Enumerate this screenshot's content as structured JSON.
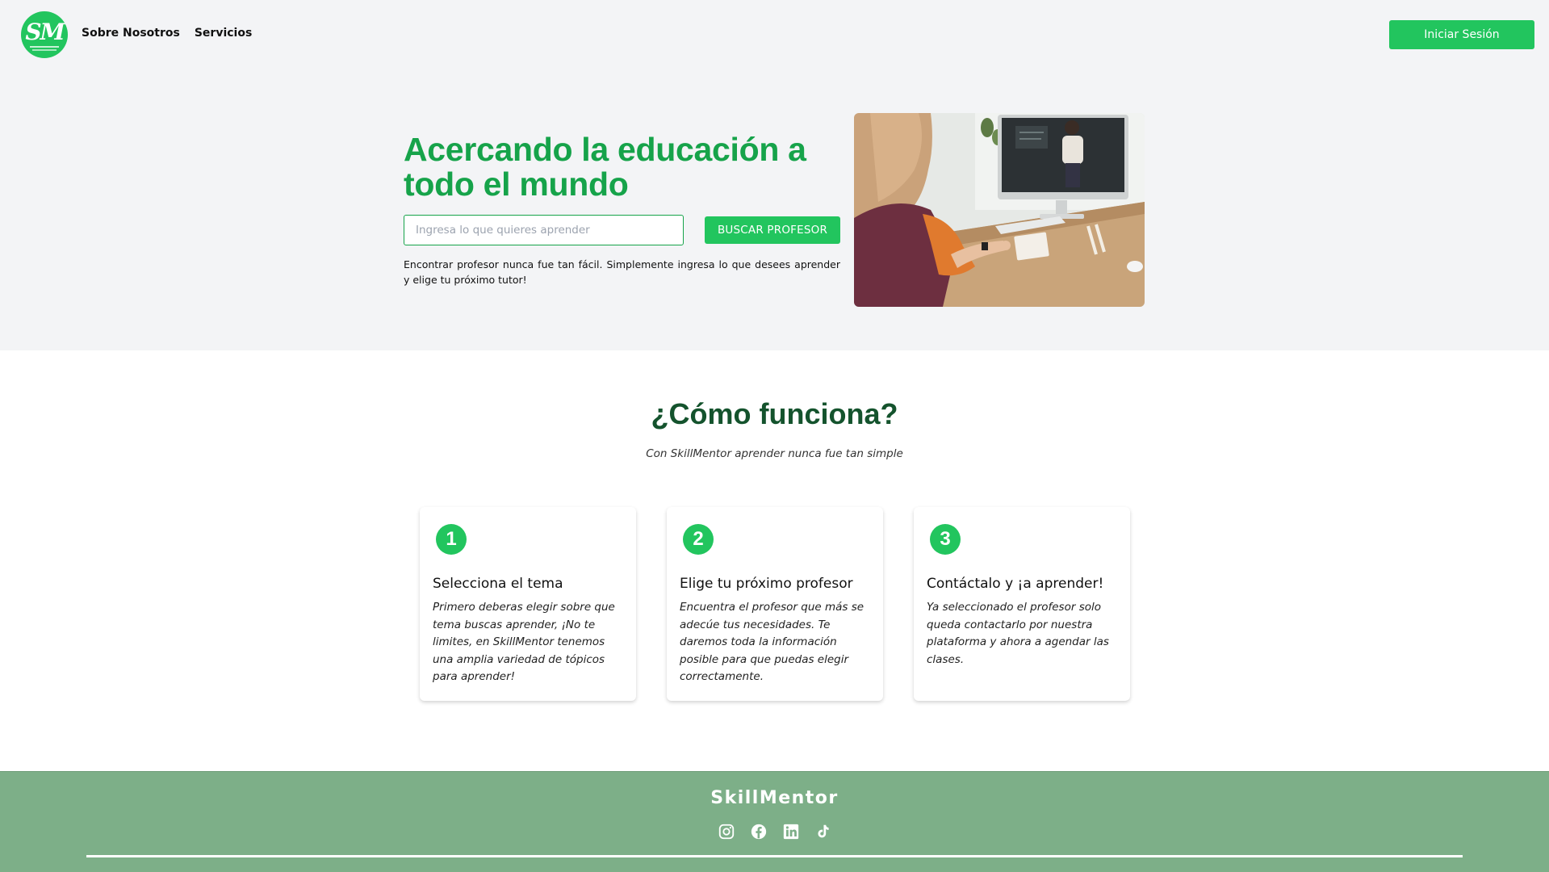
{
  "nav": {
    "logo_text": "SM",
    "links": [
      {
        "label": "Sobre Nosotros"
      },
      {
        "label": "Servicios"
      }
    ],
    "login_label": "Iniciar Sesión"
  },
  "hero": {
    "title": "Acercando la educación a todo el mundo",
    "search_placeholder": "Ingresa lo que quieres aprender",
    "search_button": "BUSCAR PROFESOR",
    "description": "Encontrar profesor nunca fue tan fácil. Simplemente ingresa lo que desees aprender y elige tu próximo tutor!"
  },
  "how": {
    "title": "¿Cómo funciona?",
    "subtitle": "Con SkillMentor aprender nunca fue tan simple",
    "steps": [
      {
        "number": "1",
        "title": "Selecciona el tema",
        "text": "Primero deberas elegir sobre que tema buscas aprender, ¡No te limites, en SkillMentor tenemos una amplia variedad de tópicos para aprender!"
      },
      {
        "number": "2",
        "title": "Elige tu próximo profesor",
        "text": "Encuentra el profesor que más se adecúe tus necesidades. Te daremos toda la información posible para que puedas elegir correctamente."
      },
      {
        "number": "3",
        "title": "Contáctalo y ¡a aprender!",
        "text": "Ya seleccionado el profesor solo queda contactarlo por nuestra plataforma y ahora a agendar las clases."
      }
    ]
  },
  "footer": {
    "brand": "SkillMentor",
    "social": [
      "instagram-icon",
      "facebook-icon",
      "linkedin-icon",
      "tiktok-icon"
    ]
  },
  "colors": {
    "brand_green": "#22c55e",
    "title_green": "#16a34a",
    "dark_green": "#14532d",
    "footer_green": "#7daf88",
    "band_gray": "#f3f4f6"
  }
}
